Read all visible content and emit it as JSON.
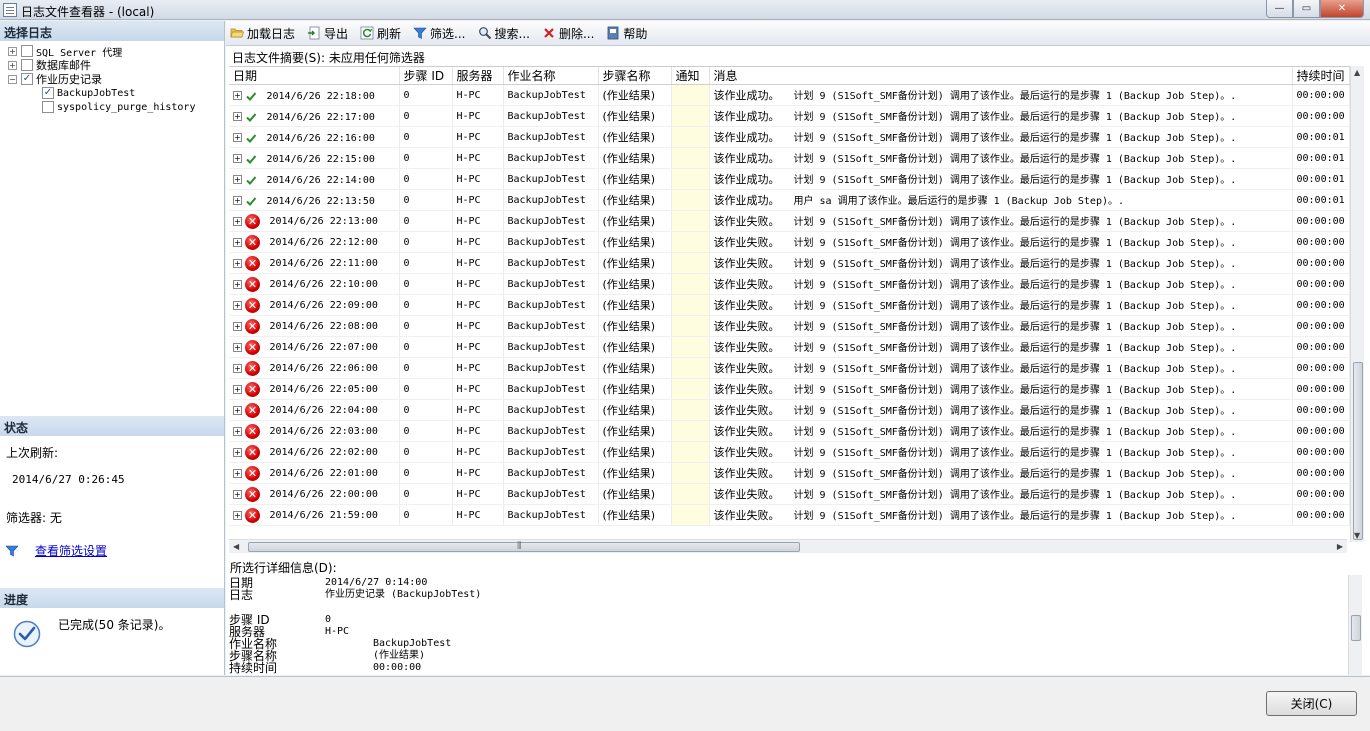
{
  "window": {
    "title": "日志文件查看器 - (local)",
    "minimize": "—",
    "maximize": "▭",
    "close": "✕"
  },
  "left": {
    "select_log_header": "选择日志",
    "tree": [
      {
        "label": "SQL Server 代理",
        "expander": "+",
        "checked": ""
      },
      {
        "label": "数据库邮件",
        "expander": "+",
        "checked": ""
      },
      {
        "label": "作业历史记录",
        "expander": "−",
        "checked": "✓"
      },
      {
        "label": "BackupJobTest",
        "expander": "",
        "checked": "✓"
      },
      {
        "label": "syspolicy_purge_history",
        "expander": "",
        "checked": ""
      }
    ],
    "status_header": "状态",
    "last_refresh_label": "上次刷新:",
    "last_refresh_value": "2014/6/27 0:26:45",
    "filter_label": "筛选器: 无",
    "view_filter_link": "查看筛选设置",
    "progress_header": "进度",
    "progress_text": "已完成(50 条记录)。"
  },
  "toolbar": {
    "load_log": "加载日志",
    "export": "导出",
    "refresh": "刷新",
    "filter": "筛选...",
    "search": "搜索...",
    "delete": "删除...",
    "help": "帮助"
  },
  "summary": "日志文件摘要(S): 未应用任何筛选器",
  "columns": [
    "日期",
    "步骤 ID",
    "服务器",
    "作业名称",
    "步骤名称",
    "通知",
    "消息",
    "持续时间"
  ],
  "rows": [
    {
      "status": "ok",
      "date": "2014/6/26 22:18:00",
      "step_id": "0",
      "server": "H-PC",
      "job": "BackupJobTest",
      "step": "(作业结果)",
      "msg1": "该作业成功。",
      "msg2": "计划 9 (S1Soft_SMF备份计划) 调用了该作业。最后运行的是步骤 1 (Backup Job Step)。.",
      "dur": "00:00:00"
    },
    {
      "status": "ok",
      "date": "2014/6/26 22:17:00",
      "step_id": "0",
      "server": "H-PC",
      "job": "BackupJobTest",
      "step": "(作业结果)",
      "msg1": "该作业成功。",
      "msg2": "计划 9 (S1Soft_SMF备份计划) 调用了该作业。最后运行的是步骤 1 (Backup Job Step)。.",
      "dur": "00:00:00"
    },
    {
      "status": "ok",
      "date": "2014/6/26 22:16:00",
      "step_id": "0",
      "server": "H-PC",
      "job": "BackupJobTest",
      "step": "(作业结果)",
      "msg1": "该作业成功。",
      "msg2": "计划 9 (S1Soft_SMF备份计划) 调用了该作业。最后运行的是步骤 1 (Backup Job Step)。.",
      "dur": "00:00:01"
    },
    {
      "status": "ok",
      "date": "2014/6/26 22:15:00",
      "step_id": "0",
      "server": "H-PC",
      "job": "BackupJobTest",
      "step": "(作业结果)",
      "msg1": "该作业成功。",
      "msg2": "计划 9 (S1Soft_SMF备份计划) 调用了该作业。最后运行的是步骤 1 (Backup Job Step)。.",
      "dur": "00:00:01"
    },
    {
      "status": "ok",
      "date": "2014/6/26 22:14:00",
      "step_id": "0",
      "server": "H-PC",
      "job": "BackupJobTest",
      "step": "(作业结果)",
      "msg1": "该作业成功。",
      "msg2": "计划 9 (S1Soft_SMF备份计划) 调用了该作业。最后运行的是步骤 1 (Backup Job Step)。.",
      "dur": "00:00:01"
    },
    {
      "status": "ok",
      "date": "2014/6/26 22:13:50",
      "step_id": "0",
      "server": "H-PC",
      "job": "BackupJobTest",
      "step": "(作业结果)",
      "msg1": "该作业成功。",
      "msg2": "用户 sa 调用了该作业。最后运行的是步骤 1 (Backup Job Step)。.",
      "dur": "00:00:01"
    },
    {
      "status": "err",
      "date": "2014/6/26 22:13:00",
      "step_id": "0",
      "server": "H-PC",
      "job": "BackupJobTest",
      "step": "(作业结果)",
      "msg1": "该作业失败。",
      "msg2": "计划 9 (S1Soft_SMF备份计划) 调用了该作业。最后运行的是步骤 1 (Backup Job Step)。.",
      "dur": "00:00:00"
    },
    {
      "status": "err",
      "date": "2014/6/26 22:12:00",
      "step_id": "0",
      "server": "H-PC",
      "job": "BackupJobTest",
      "step": "(作业结果)",
      "msg1": "该作业失败。",
      "msg2": "计划 9 (S1Soft_SMF备份计划) 调用了该作业。最后运行的是步骤 1 (Backup Job Step)。.",
      "dur": "00:00:00"
    },
    {
      "status": "err",
      "date": "2014/6/26 22:11:00",
      "step_id": "0",
      "server": "H-PC",
      "job": "BackupJobTest",
      "step": "(作业结果)",
      "msg1": "该作业失败。",
      "msg2": "计划 9 (S1Soft_SMF备份计划) 调用了该作业。最后运行的是步骤 1 (Backup Job Step)。.",
      "dur": "00:00:00"
    },
    {
      "status": "err",
      "date": "2014/6/26 22:10:00",
      "step_id": "0",
      "server": "H-PC",
      "job": "BackupJobTest",
      "step": "(作业结果)",
      "msg1": "该作业失败。",
      "msg2": "计划 9 (S1Soft_SMF备份计划) 调用了该作业。最后运行的是步骤 1 (Backup Job Step)。.",
      "dur": "00:00:00"
    },
    {
      "status": "err",
      "date": "2014/6/26 22:09:00",
      "step_id": "0",
      "server": "H-PC",
      "job": "BackupJobTest",
      "step": "(作业结果)",
      "msg1": "该作业失败。",
      "msg2": "计划 9 (S1Soft_SMF备份计划) 调用了该作业。最后运行的是步骤 1 (Backup Job Step)。.",
      "dur": "00:00:00"
    },
    {
      "status": "err",
      "date": "2014/6/26 22:08:00",
      "step_id": "0",
      "server": "H-PC",
      "job": "BackupJobTest",
      "step": "(作业结果)",
      "msg1": "该作业失败。",
      "msg2": "计划 9 (S1Soft_SMF备份计划) 调用了该作业。最后运行的是步骤 1 (Backup Job Step)。.",
      "dur": "00:00:00"
    },
    {
      "status": "err",
      "date": "2014/6/26 22:07:00",
      "step_id": "0",
      "server": "H-PC",
      "job": "BackupJobTest",
      "step": "(作业结果)",
      "msg1": "该作业失败。",
      "msg2": "计划 9 (S1Soft_SMF备份计划) 调用了该作业。最后运行的是步骤 1 (Backup Job Step)。.",
      "dur": "00:00:00"
    },
    {
      "status": "err",
      "date": "2014/6/26 22:06:00",
      "step_id": "0",
      "server": "H-PC",
      "job": "BackupJobTest",
      "step": "(作业结果)",
      "msg1": "该作业失败。",
      "msg2": "计划 9 (S1Soft_SMF备份计划) 调用了该作业。最后运行的是步骤 1 (Backup Job Step)。.",
      "dur": "00:00:00"
    },
    {
      "status": "err",
      "date": "2014/6/26 22:05:00",
      "step_id": "0",
      "server": "H-PC",
      "job": "BackupJobTest",
      "step": "(作业结果)",
      "msg1": "该作业失败。",
      "msg2": "计划 9 (S1Soft_SMF备份计划) 调用了该作业。最后运行的是步骤 1 (Backup Job Step)。.",
      "dur": "00:00:00"
    },
    {
      "status": "err",
      "date": "2014/6/26 22:04:00",
      "step_id": "0",
      "server": "H-PC",
      "job": "BackupJobTest",
      "step": "(作业结果)",
      "msg1": "该作业失败。",
      "msg2": "计划 9 (S1Soft_SMF备份计划) 调用了该作业。最后运行的是步骤 1 (Backup Job Step)。.",
      "dur": "00:00:00"
    },
    {
      "status": "err",
      "date": "2014/6/26 22:03:00",
      "step_id": "0",
      "server": "H-PC",
      "job": "BackupJobTest",
      "step": "(作业结果)",
      "msg1": "该作业失败。",
      "msg2": "计划 9 (S1Soft_SMF备份计划) 调用了该作业。最后运行的是步骤 1 (Backup Job Step)。.",
      "dur": "00:00:00"
    },
    {
      "status": "err",
      "date": "2014/6/26 22:02:00",
      "step_id": "0",
      "server": "H-PC",
      "job": "BackupJobTest",
      "step": "(作业结果)",
      "msg1": "该作业失败。",
      "msg2": "计划 9 (S1Soft_SMF备份计划) 调用了该作业。最后运行的是步骤 1 (Backup Job Step)。.",
      "dur": "00:00:00"
    },
    {
      "status": "err",
      "date": "2014/6/26 22:01:00",
      "step_id": "0",
      "server": "H-PC",
      "job": "BackupJobTest",
      "step": "(作业结果)",
      "msg1": "该作业失败。",
      "msg2": "计划 9 (S1Soft_SMF备份计划) 调用了该作业。最后运行的是步骤 1 (Backup Job Step)。.",
      "dur": "00:00:00"
    },
    {
      "status": "err",
      "date": "2014/6/26 22:00:00",
      "step_id": "0",
      "server": "H-PC",
      "job": "BackupJobTest",
      "step": "(作业结果)",
      "msg1": "该作业失败。",
      "msg2": "计划 9 (S1Soft_SMF备份计划) 调用了该作业。最后运行的是步骤 1 (Backup Job Step)。.",
      "dur": "00:00:00"
    },
    {
      "status": "err",
      "date": "2014/6/26 21:59:00",
      "step_id": "0",
      "server": "H-PC",
      "job": "BackupJobTest",
      "step": "(作业结果)",
      "msg1": "该作业失败。",
      "msg2": "计划 9 (S1Soft_SMF备份计划) 调用了该作业。最后运行的是步骤 1 (Backup Job Step)。.",
      "dur": "00:00:00"
    }
  ],
  "scroll": {
    "h_grip": "⦀"
  },
  "details": {
    "header": "所选行详细信息(D):",
    "fields": [
      {
        "label": "日期",
        "value": "2014/6/27 0:14:00"
      },
      {
        "label": "日志",
        "value": "作业历史记录 (BackupJobTest)"
      },
      {
        "label": "步骤 ID",
        "value": "0"
      },
      {
        "label": "服务器",
        "value": "H-PC"
      },
      {
        "label": "作业名称",
        "value": "BackupJobTest"
      },
      {
        "label": "步骤名称",
        "value": "(作业结果)"
      },
      {
        "label": "持续时间",
        "value": "00:00:00"
      }
    ]
  },
  "close_button": "关闭(C)",
  "colors": {
    "error": "#d10000",
    "success": "#2e8b2e",
    "notify_bg": "#fffde0",
    "link": "#0000cc"
  }
}
